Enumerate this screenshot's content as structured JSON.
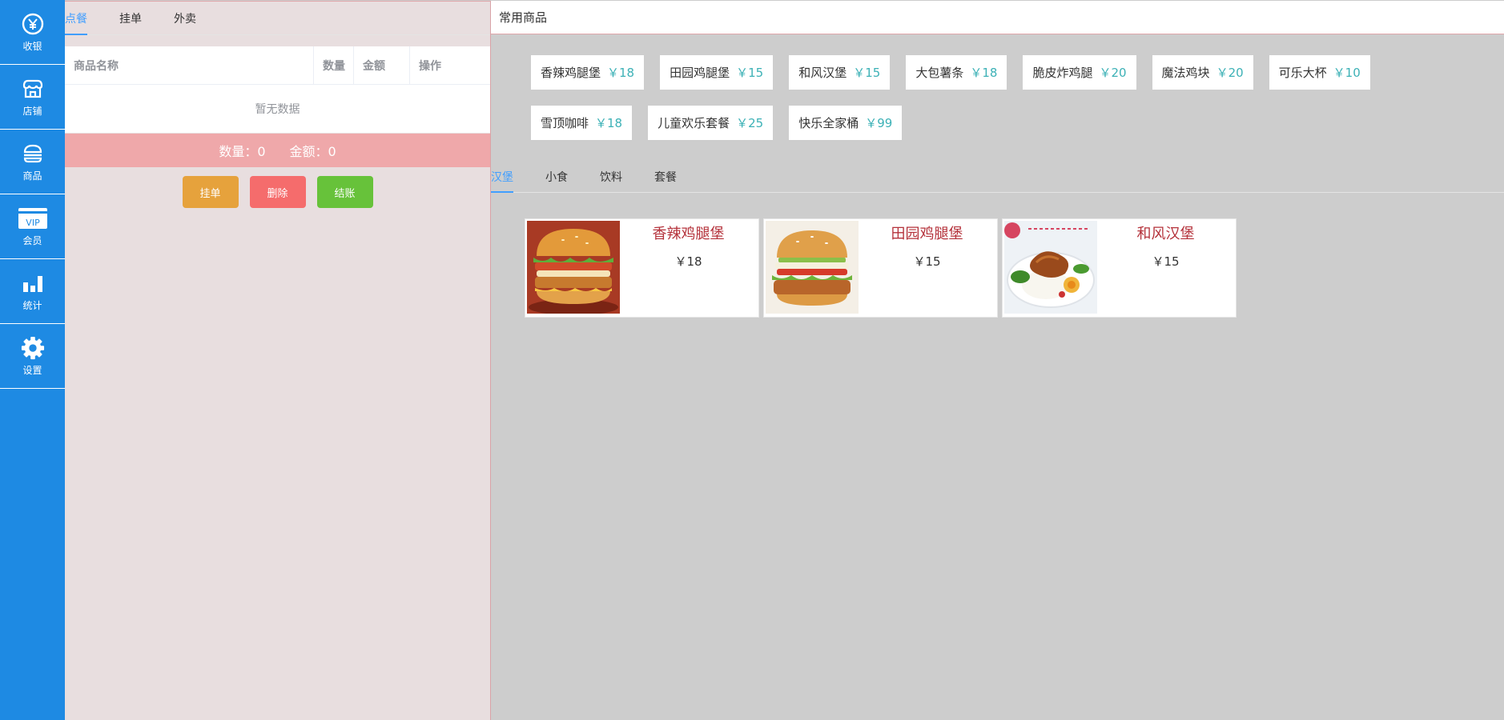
{
  "sidebar": {
    "items": [
      {
        "label": "收银",
        "icon": "cashier-icon"
      },
      {
        "label": "店铺",
        "icon": "store-icon"
      },
      {
        "label": "商品",
        "icon": "burger-icon"
      },
      {
        "label": "会员",
        "icon": "vip-card-icon",
        "badge": "VIP"
      },
      {
        "label": "统计",
        "icon": "bar-chart-icon"
      },
      {
        "label": "设置",
        "icon": "gear-icon"
      }
    ]
  },
  "order": {
    "tabs": [
      "点餐",
      "挂单",
      "外卖"
    ],
    "active_tab": "点餐",
    "columns": [
      "商品名称",
      "数量",
      "金额",
      "操作"
    ],
    "empty_text": "暂无数据",
    "summary": {
      "count_label": "数量：0",
      "amount_label": "金额：0"
    },
    "buttons": {
      "hold": "挂单",
      "delete": "删除",
      "checkout": "结账"
    }
  },
  "frequent": {
    "title": "常用商品",
    "items": [
      {
        "name": "香辣鸡腿堡",
        "price": "￥18"
      },
      {
        "name": "田园鸡腿堡",
        "price": "￥15"
      },
      {
        "name": "和风汉堡",
        "price": "￥15"
      },
      {
        "name": "大包薯条",
        "price": "￥18"
      },
      {
        "name": "脆皮炸鸡腿",
        "price": "￥20"
      },
      {
        "name": "魔法鸡块",
        "price": "￥20"
      },
      {
        "name": "可乐大杯",
        "price": "￥10"
      },
      {
        "name": "雪顶咖啡",
        "price": "￥18"
      },
      {
        "name": "儿童欢乐套餐",
        "price": "￥25"
      },
      {
        "name": "快乐全家桶",
        "price": "￥99"
      }
    ]
  },
  "categories": {
    "tabs": [
      "汉堡",
      "小食",
      "饮料",
      "套餐"
    ],
    "active_tab": "汉堡"
  },
  "goods": [
    {
      "name": "香辣鸡腿堡",
      "price": "￥18"
    },
    {
      "name": "田园鸡腿堡",
      "price": "￥15"
    },
    {
      "name": "和风汉堡",
      "price": "￥15"
    }
  ],
  "colors": {
    "sidebar": "#1e8ae3",
    "accent": "#409eff",
    "hold_button": "#e6a23c",
    "delete_button": "#f56c6c",
    "checkout_button": "#67c23a",
    "price_teal": "#3cb1b6",
    "goods_name": "#b4313a"
  }
}
